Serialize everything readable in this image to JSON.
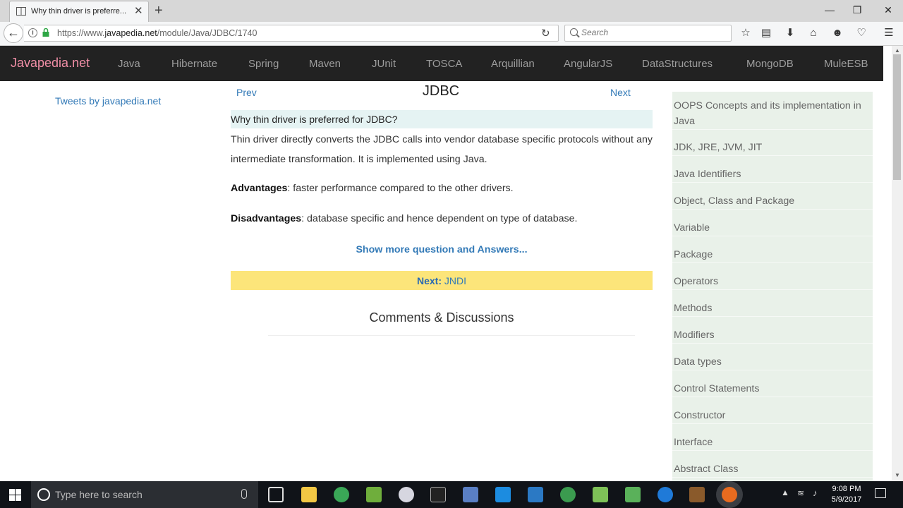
{
  "browser": {
    "tab_title": "Why thin driver is preferre...",
    "close_glyph": "✕",
    "new_tab_glyph": "+",
    "url_prefix": "https://www.",
    "url_domain": "javapedia.net",
    "url_path": "/module/Java/JDBC/1740",
    "search_placeholder": "Search",
    "window_controls": {
      "minimize": "—",
      "maximize": "❐",
      "close": "✕"
    }
  },
  "site": {
    "brand": "Javapedia.net",
    "nav": [
      "Java",
      "Hibernate",
      "Spring",
      "Maven",
      "JUnit",
      "TOSCA",
      "Arquillian",
      "AngularJS",
      "DataStructures",
      "MongoDB",
      "MuleESB"
    ]
  },
  "left": {
    "tweets_link": "Tweets by javapedia.net"
  },
  "main": {
    "prev": "Prev",
    "title": "JDBC",
    "next": "Next",
    "question": "Why thin driver is preferred for JDBC?",
    "answer": "Thin driver directly converts the JDBC calls into vendor database specific protocols without any intermediate transformation. It is implemented using Java.",
    "adv_label": "Advantages",
    "adv_text": ": faster performance compared to the other drivers.",
    "disadv_label": "Disadvantages",
    "disadv_text": ": database specific and hence dependent on type of database.",
    "more_link": "Show more question and Answers...",
    "next_label": "Next:",
    "next_topic": "JNDI",
    "comments_title": "Comments & Discussions"
  },
  "sidebar": {
    "items": [
      "OOPS Concepts and its implementation in Java",
      "JDK, JRE, JVM, JIT",
      "Java Identifiers",
      "Object, Class and Package",
      "Variable",
      "Package",
      "Operators",
      "Methods",
      "Modifiers",
      "Data types",
      "Control Statements",
      "Constructor",
      "Interface",
      "Abstract Class"
    ]
  },
  "taskbar": {
    "search_placeholder": "Type here to search",
    "time": "9:08 PM",
    "date": "5/9/2017"
  },
  "colors": {
    "brand": "#f28fa7",
    "link": "#337ab7",
    "nav_bg": "#222222",
    "next_bar": "#fce57a",
    "question_bg": "#e5f3f3",
    "sidebar_bg": "#e9f1e9"
  }
}
